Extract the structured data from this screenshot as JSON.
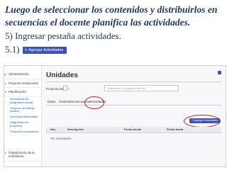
{
  "heading": "Luego de seleccionar los contenidos y distribuirlos en secuencias el docente planifica las actividades.",
  "step5": "5) Ingresar pestaña actividades.",
  "step51": "5.1)",
  "sample_button": {
    "label": "Agregar Actividades",
    "icon": "plus-icon"
  },
  "colors": {
    "heading": "#1f3864",
    "button": "#3f51b5",
    "highlight": "#cc1f2f"
  },
  "app": {
    "sidebar": [
      {
        "label": "Administración",
        "children": []
      },
      {
        "label": "Proyecto Institucional",
        "children": []
      },
      {
        "label": "Planificación",
        "children": [
          "Información de Diagnóstico Inicial",
          "Proyecto de trabajo (áulico)",
          "Lecciones Aprendidas",
          "Diagnóstico en proyectos",
          "Proyectos compartidos"
        ]
      },
      {
        "label": "Organización de la enseñanza",
        "children": []
      }
    ],
    "page_title": "Unidades",
    "project_label": "Proyecto áulico",
    "project_select_marker": "*",
    "search_placeholder": "Seleccione un proyecto de Art",
    "tabs": [
      "Datos",
      "Contenidos",
      "Secuencias",
      "Actividades"
    ],
    "add_button": "Agregar Actividades",
    "table_headers": [
      "Nro.",
      "Descripción",
      "Fecha desde",
      "Fecha hasta"
    ],
    "empty_text": "Sin actividades"
  }
}
